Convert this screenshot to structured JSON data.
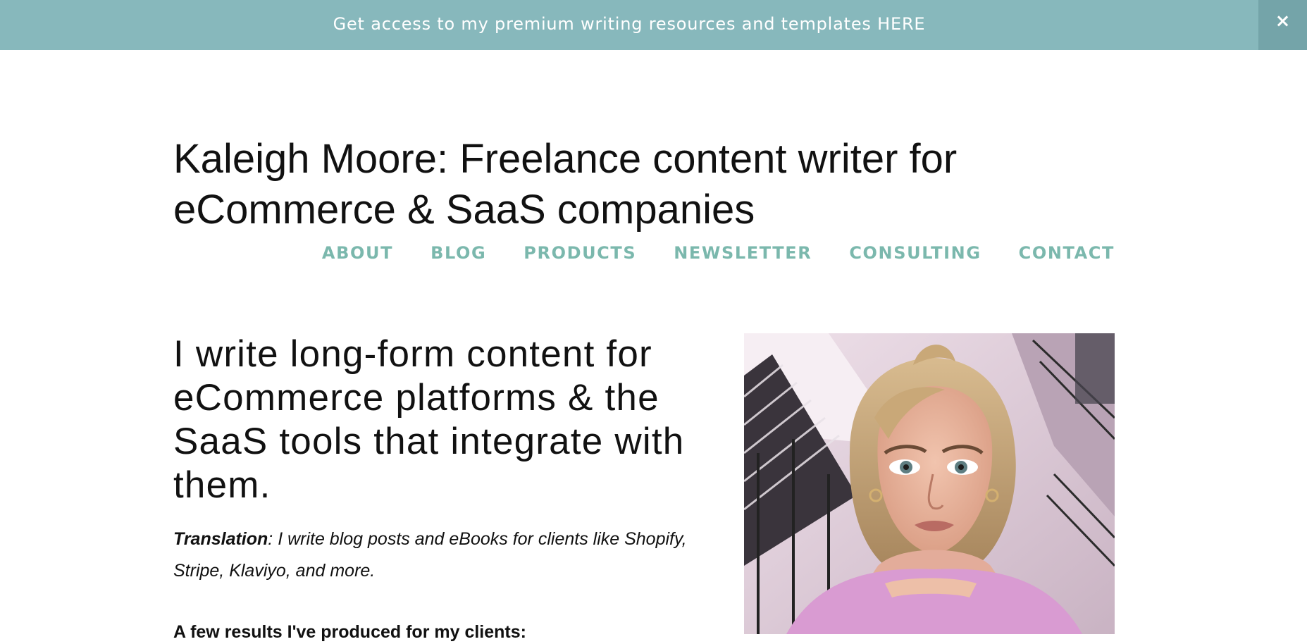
{
  "banner": {
    "text": "Get access to my premium writing resources and templates HERE",
    "close_label": "×"
  },
  "header": {
    "title": "Kaleigh Moore: Freelance content writer for eCommerce & SaaS companies"
  },
  "nav": {
    "items": [
      "ABOUT",
      "BLOG",
      "PRODUCTS",
      "NEWSLETTER",
      "CONSULTING",
      "CONTACT"
    ]
  },
  "hero": {
    "heading": "I write long-form content for eCommerce platforms & the SaaS tools that integrate with them.",
    "translation_label": "Translation",
    "translation_text": ": I write blog posts and eBooks for clients like Shopify, Stripe, Klaviyo, and more.",
    "results_heading": "A few results I've produced for my clients:"
  },
  "colors": {
    "banner_bg": "#87b8bc",
    "banner_close_bg": "#74a4a9",
    "nav_accent": "#7bb8ad",
    "text": "#111111"
  },
  "icons": {
    "close": "close-icon"
  }
}
